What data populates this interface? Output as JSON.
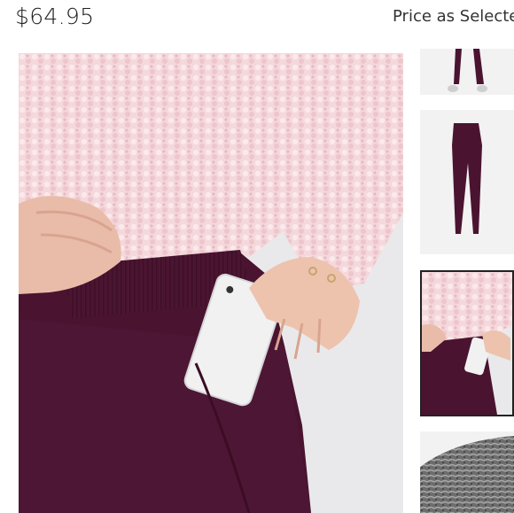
{
  "product": {
    "price": "$64.95",
    "price_note": "Price as Selected"
  },
  "gallery": {
    "main_image_alt": "Model wearing pink sherpa pullover and plum leggings with phone in side pocket",
    "selected_thumbnail": 3,
    "thumbnails": [
      {
        "alt": "Leggings worn with sneakers"
      },
      {
        "alt": "Plum leggings flat lay"
      },
      {
        "alt": "Leggings side pocket detail"
      },
      {
        "alt": "Heather gray fabric swatch"
      }
    ]
  },
  "colors": {
    "plum": "#4a1430",
    "sherpa_pink": "#f2d3d8",
    "selected_border": "#222222"
  }
}
